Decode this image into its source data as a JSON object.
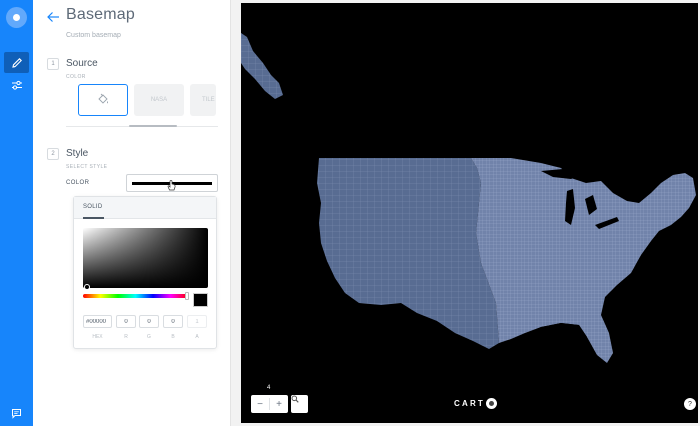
{
  "rail": {
    "logo_icon": "carto-logo-icon",
    "items": [
      {
        "icon": "pencil-icon",
        "active": true
      },
      {
        "icon": "sliders-icon",
        "active": false
      }
    ],
    "footer_icon": "chat-icon"
  },
  "panel": {
    "title": "Basemap",
    "subtitle": "Custom basemap",
    "steps": [
      {
        "number": "1",
        "title": "Source",
        "hint": "COLOR"
      },
      {
        "number": "2",
        "title": "Style",
        "hint": "SELECT STYLE"
      }
    ],
    "source_options": [
      {
        "label": "",
        "icon": "paint-bucket-icon",
        "selected": true
      },
      {
        "label": "NASA",
        "selected": false
      },
      {
        "label": "TILE",
        "selected": false
      }
    ],
    "style": {
      "color_label": "COLOR",
      "color_value": "#000000"
    }
  },
  "picker": {
    "tab": "SOLID",
    "hex_value": "#00000",
    "r": "0",
    "g": "0",
    "b": "0",
    "a": "1",
    "labels": [
      "HEX",
      "R",
      "G",
      "B",
      "A"
    ]
  },
  "map": {
    "zoom_level": "4",
    "zoom_out": "−",
    "zoom_in": "+",
    "brand": "CART",
    "help": "?",
    "land_color": "#5f7398",
    "background": "#000000"
  }
}
